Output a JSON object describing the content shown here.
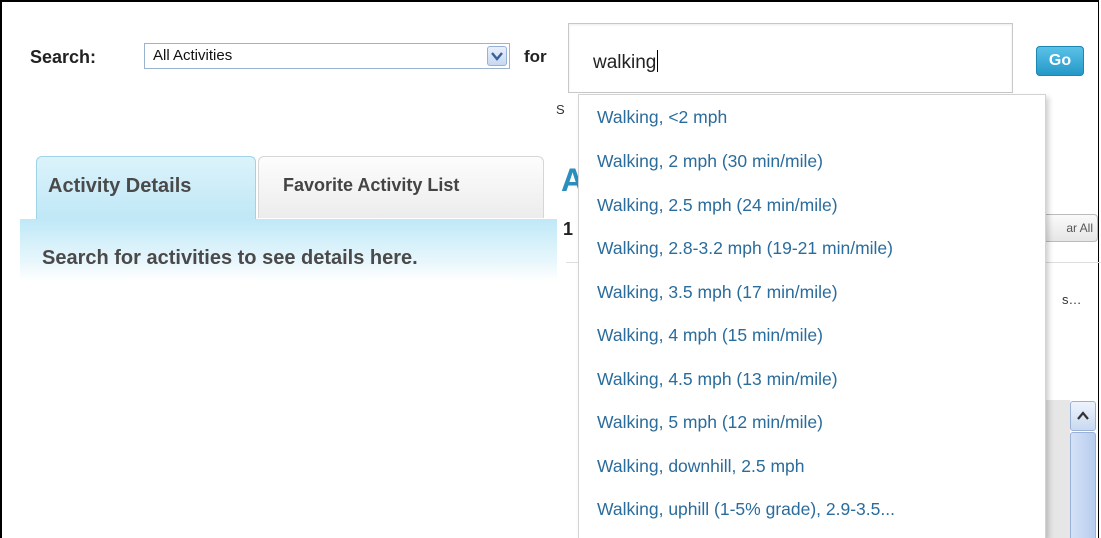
{
  "search": {
    "label": "Search:",
    "category_value": "All Activities",
    "for_label": "for",
    "query": "walking",
    "go_label": "Go"
  },
  "tabs": {
    "active_label": "Activity Details",
    "inactive_label": "Favorite Activity List"
  },
  "details": {
    "message": "Search for activities to see details here."
  },
  "background": {
    "heading_letter": "A",
    "count_digit": "1",
    "hint_letter": "S",
    "clear_label": "ar All",
    "ellipsis": "s…"
  },
  "autocomplete": {
    "items": [
      "Walking, <2 mph",
      "Walking, 2 mph (30 min/mile)",
      "Walking, 2.5 mph (24 min/mile)",
      "Walking, 2.8-3.2 mph (19-21 min/mile)",
      "Walking, 3.5 mph (17 min/mile)",
      "Walking, 4 mph (15 min/mile)",
      "Walking, 4.5 mph (13 min/mile)",
      "Walking, 5 mph (12 min/mile)",
      "Walking, downhill, 2.5 mph",
      "Walking, uphill (1-5% grade), 2.9-3.5..."
    ]
  },
  "icons": {
    "dropdown_arrow": "chevron-down-icon",
    "scroll_up": "chevron-up-icon"
  },
  "colors": {
    "link_blue": "#2a6c9c",
    "go_button": "#2397c7",
    "tab_active": "#bfe7f6"
  }
}
